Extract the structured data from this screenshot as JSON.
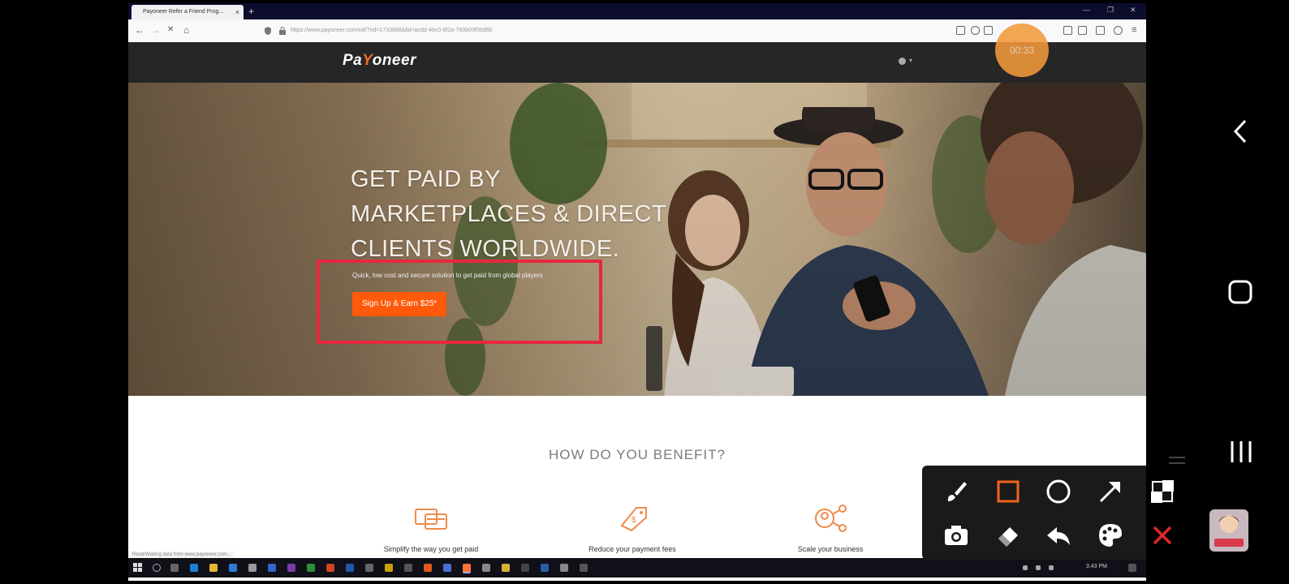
{
  "browser": {
    "tab_title": "Payoneer Refer a Friend Prog...",
    "tab_close": "×",
    "new_tab": "+",
    "url": "https://www.payoneer.com/raf/?rid=1733698&lid=acdd-4bc0-8f2a-793b03f00d6b",
    "nav_back": "←",
    "nav_forward": "→",
    "nav_stop": "✕",
    "nav_home": "⌂",
    "status_text": "Read/Waiting data from www.payoneer.com..."
  },
  "site": {
    "logo_pre": "Pa",
    "logo_y": "Y",
    "logo_post": "oneer",
    "hero_lines": [
      "GET PAID BY",
      "MARKETPLACES & DIRECT",
      "CLIENTS WORLDWIDE."
    ],
    "hero_sub": "Quick, low cost and secure solution to get paid from global players",
    "cta": "Sign Up & Earn $25*",
    "benefits_title": "HOW DO YOU BENEFIT?",
    "benefits": [
      {
        "label": "Simplify the way you get paid"
      },
      {
        "label": "Reduce your payment fees"
      },
      {
        "label": "Scale your business"
      }
    ]
  },
  "recorder": {
    "timer": "00:33"
  },
  "taskbar": {
    "clock": "3:43 PM"
  },
  "colors": {
    "brand_orange": "#ff5a0a",
    "annotation_red": "#e8273f",
    "header_dark": "#262626"
  },
  "icons": {
    "draw_tools": [
      "brush-icon",
      "rectangle-icon",
      "circle-icon",
      "arrow-icon",
      "camera-icon",
      "eraser-icon",
      "undo-icon",
      "palette-icon"
    ],
    "side_tools": [
      "checker-icon",
      "close-icon"
    ],
    "android_nav": [
      "back-icon",
      "home-icon",
      "recents-icon"
    ]
  }
}
